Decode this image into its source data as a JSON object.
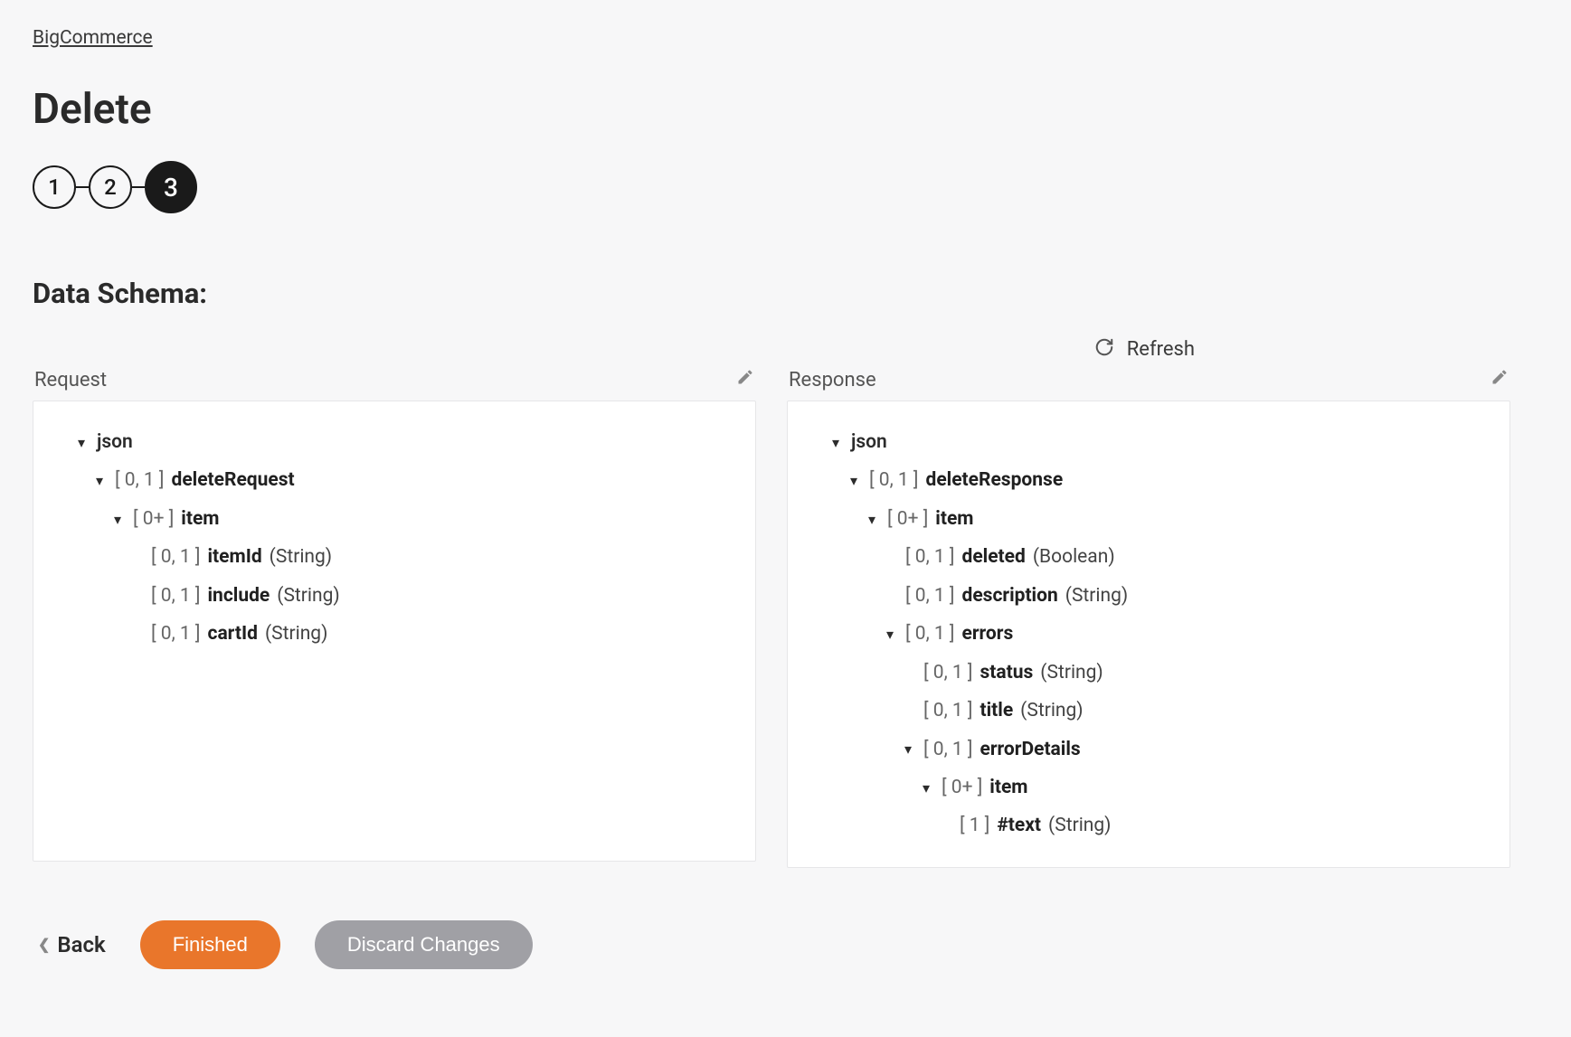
{
  "breadcrumb": {
    "label": "BigCommerce"
  },
  "page_title": "Delete",
  "steps": [
    "1",
    "2",
    "3"
  ],
  "section_title": "Data Schema:",
  "refresh_label": "Refresh",
  "panels": {
    "request_label": "Request",
    "response_label": "Response"
  },
  "request_tree": {
    "root": "json",
    "l1_card": "[ 0, 1 ]",
    "l1_name": "deleteRequest",
    "l2_card": "[ 0+ ]",
    "l2_name": "item",
    "f1_card": "[ 0, 1 ]",
    "f1_name": "itemId",
    "f1_type": "(String)",
    "f2_card": "[ 0, 1 ]",
    "f2_name": "include",
    "f2_type": "(String)",
    "f3_card": "[ 0, 1 ]",
    "f3_name": "cartId",
    "f3_type": "(String)"
  },
  "response_tree": {
    "root": "json",
    "l1_card": "[ 0, 1 ]",
    "l1_name": "deleteResponse",
    "l2_card": "[ 0+ ]",
    "l2_name": "item",
    "f1_card": "[ 0, 1 ]",
    "f1_name": "deleted",
    "f1_type": "(Boolean)",
    "f2_card": "[ 0, 1 ]",
    "f2_name": "description",
    "f2_type": "(String)",
    "err_card": "[ 0, 1 ]",
    "err_name": "errors",
    "es_card": "[ 0, 1 ]",
    "es_name": "status",
    "es_type": "(String)",
    "et_card": "[ 0, 1 ]",
    "et_name": "title",
    "et_type": "(String)",
    "ed_card": "[ 0, 1 ]",
    "ed_name": "errorDetails",
    "edi_card": "[ 0+ ]",
    "edi_name": "item",
    "txt_card": "[ 1 ]",
    "txt_name": "#text",
    "txt_type": "(String)"
  },
  "footer": {
    "back": "Back",
    "finished": "Finished",
    "discard": "Discard Changes"
  }
}
